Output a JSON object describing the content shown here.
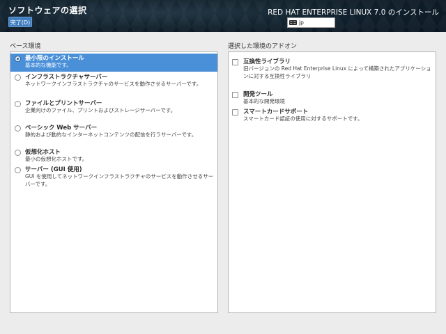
{
  "header": {
    "title": "ソフトウェアの選択",
    "done_label": "完了(D)",
    "product": "RED HAT ENTERPRISE LINUX 7.0 のインストール",
    "keyboard_layout": "jp"
  },
  "base_environment": {
    "label": "ベース環境",
    "selected_index": 0,
    "items": [
      {
        "name": "最小限のインストール",
        "desc": "基本的な機能です。"
      },
      {
        "name": "インフラストラクチャサーバー",
        "desc": "ネットワークインフラストラクチャのサービスを動作させるサーバーです。"
      },
      {
        "name": "ファイルとプリントサーバー",
        "desc": "企業向けのファイル、プリントおよびストレージサーバーです。"
      },
      {
        "name": "ベーシック Web サーバー",
        "desc": "静的および動的なインターネットコンテンツの配信を行うサーバーです。"
      },
      {
        "name": "仮想化ホスト",
        "desc": "最小の仮想化ホストです。"
      },
      {
        "name": "サーバー (GUI 使用)",
        "desc": "GUI を使用してネットワークインフラストラクチャのサービスを動作させるサーバーです。"
      }
    ]
  },
  "addons": {
    "label": "選択した環境のアドオン",
    "items": [
      {
        "name": "互換性ライブラリ",
        "desc": "旧バージョンの Red Hat Enterprise Linux によって構築されたアプリケーションに対する互換性ライブラリ",
        "checked": false
      },
      {
        "name": "開発ツール",
        "desc": "基本的な開発環境",
        "checked": false
      },
      {
        "name": "スマートカードサポート",
        "desc": "スマートカード認証の使用に対するサポートです。",
        "checked": false
      }
    ]
  }
}
